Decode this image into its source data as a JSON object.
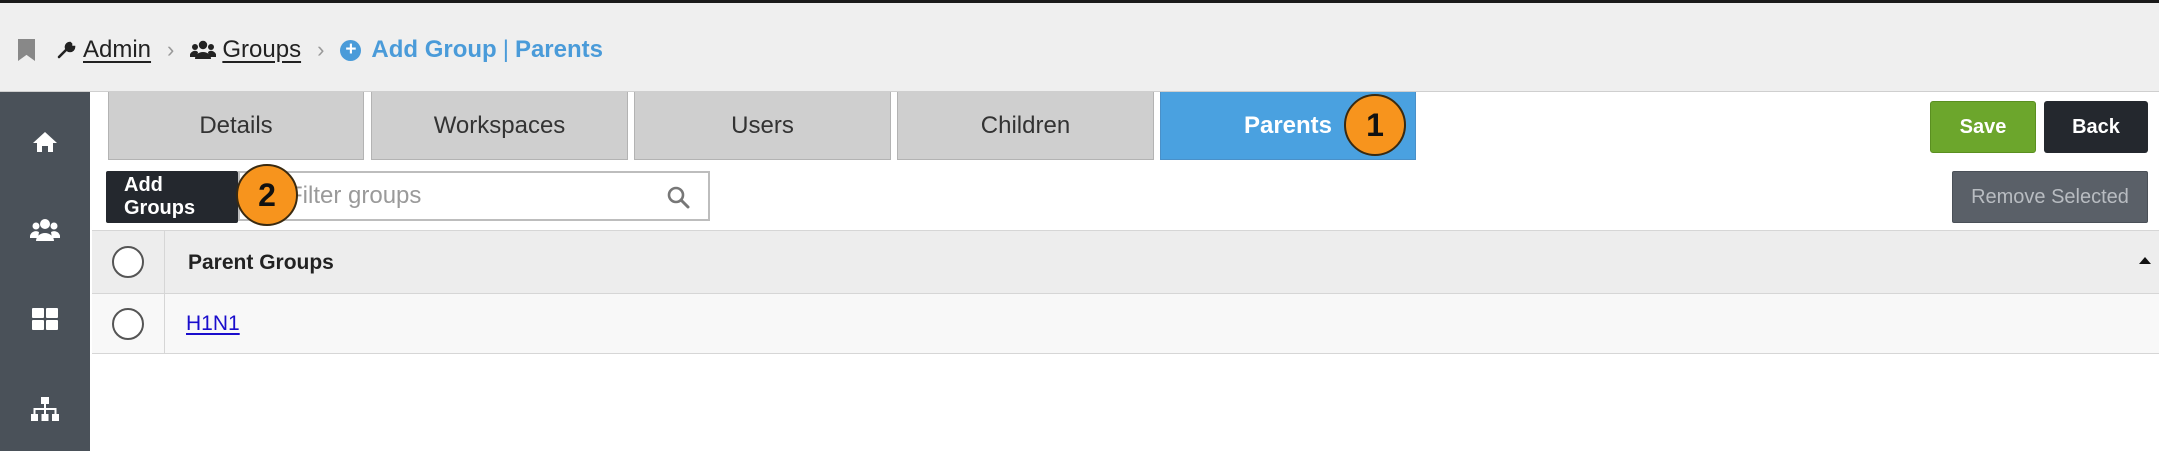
{
  "breadcrumb": {
    "admin": "Admin",
    "groups": "Groups",
    "current_action": "Add Group",
    "current_tab": "Parents"
  },
  "sidenav": {
    "items": [
      "home-icon",
      "users-icon",
      "dashboard-icon",
      "hierarchy-icon"
    ]
  },
  "tabs": [
    {
      "label": "Details",
      "active": false
    },
    {
      "label": "Workspaces",
      "active": false
    },
    {
      "label": "Users",
      "active": false
    },
    {
      "label": "Children",
      "active": false
    },
    {
      "label": "Parents",
      "active": true
    }
  ],
  "annotations": {
    "badge1": "1",
    "badge2": "2"
  },
  "toolbar": {
    "save_label": "Save",
    "back_label": "Back",
    "add_groups_label": "Add Groups",
    "filter_placeholder": "Filter groups",
    "remove_selected_label": "Remove Selected"
  },
  "table": {
    "header": "Parent Groups",
    "rows": [
      {
        "name": "H1N1"
      }
    ]
  },
  "colors": {
    "accent": "#4aa1e0",
    "save": "#6ca62c",
    "dark": "#24282e",
    "sidenav": "#4a5159",
    "badge": "#f7941d",
    "link": "#1a0dcc"
  }
}
